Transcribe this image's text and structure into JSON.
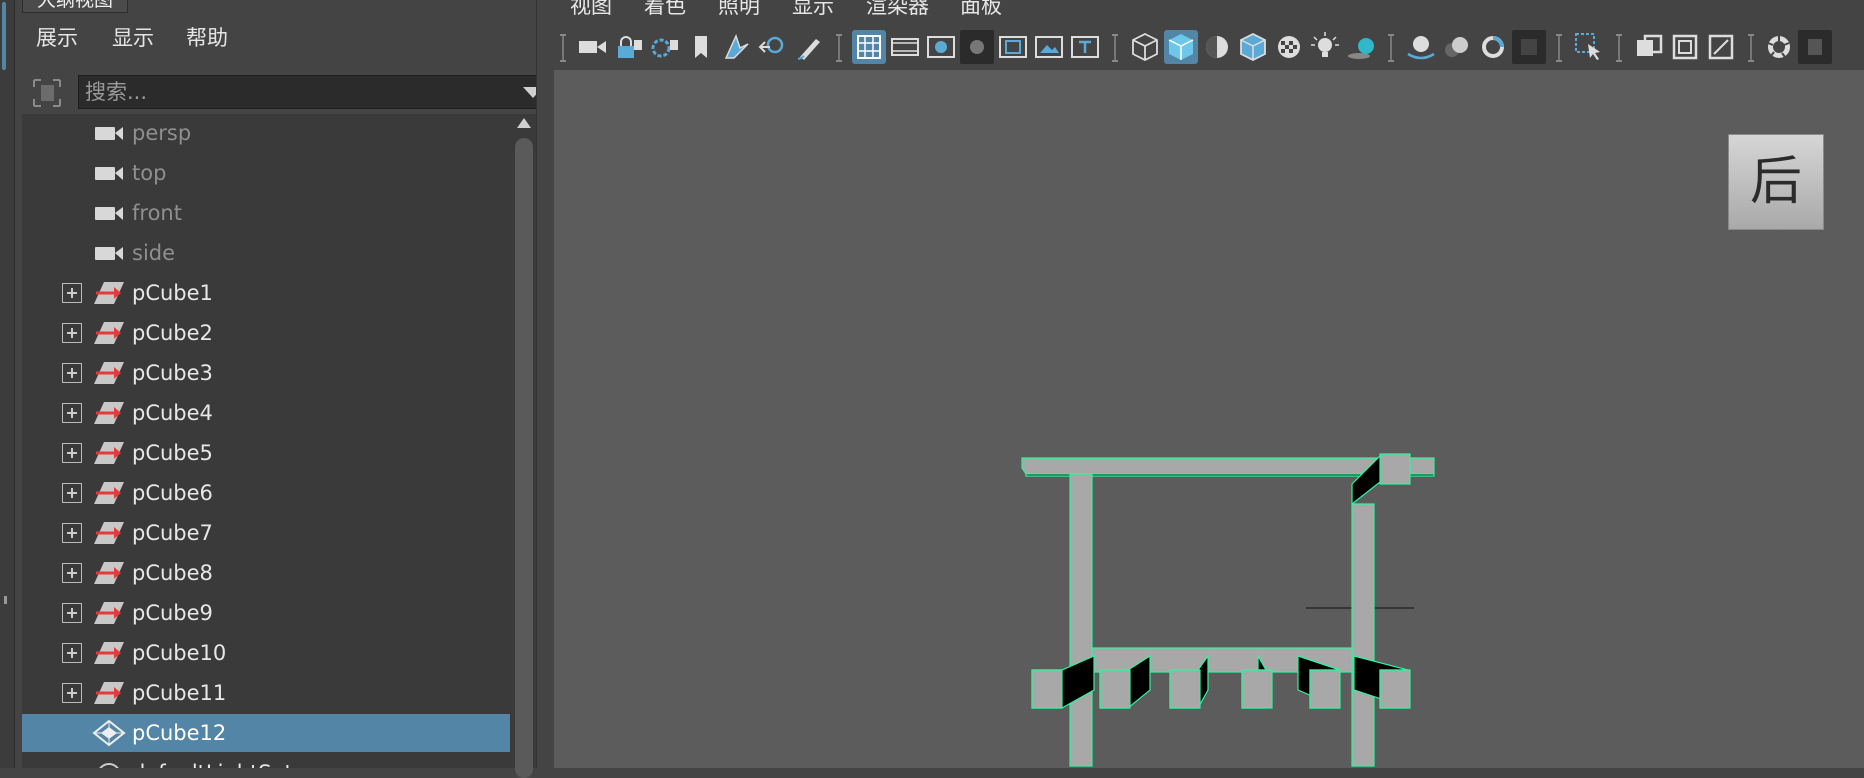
{
  "outliner": {
    "tab_title": "大纲视图",
    "menu": [
      "展示",
      "显示",
      "帮助"
    ],
    "search": {
      "placeholder": "搜索...",
      "value": ""
    },
    "items": [
      {
        "label": "persp",
        "type": "camera",
        "expandable": false,
        "dim": true
      },
      {
        "label": "top",
        "type": "camera",
        "expandable": false,
        "dim": true
      },
      {
        "label": "front",
        "type": "camera",
        "expandable": false,
        "dim": true
      },
      {
        "label": "side",
        "type": "camera",
        "expandable": false,
        "dim": true
      },
      {
        "label": "pCube1",
        "type": "mesh",
        "expandable": true
      },
      {
        "label": "pCube2",
        "type": "mesh",
        "expandable": true
      },
      {
        "label": "pCube3",
        "type": "mesh",
        "expandable": true
      },
      {
        "label": "pCube4",
        "type": "mesh",
        "expandable": true
      },
      {
        "label": "pCube5",
        "type": "mesh",
        "expandable": true
      },
      {
        "label": "pCube6",
        "type": "mesh",
        "expandable": true
      },
      {
        "label": "pCube7",
        "type": "mesh",
        "expandable": true
      },
      {
        "label": "pCube8",
        "type": "mesh",
        "expandable": true
      },
      {
        "label": "pCube9",
        "type": "mesh",
        "expandable": true
      },
      {
        "label": "pCube10",
        "type": "mesh",
        "expandable": true
      },
      {
        "label": "pCube11",
        "type": "mesh",
        "expandable": true
      },
      {
        "label": "pCube12",
        "type": "mesh-selected",
        "expandable": false,
        "selected": true
      },
      {
        "label": "defaultLightSet",
        "type": "set",
        "expandable": false
      }
    ]
  },
  "viewport": {
    "menu": [
      "视图",
      "着色",
      "照明",
      "显示",
      "渲染器",
      "面板"
    ],
    "view_cube_label": "后",
    "colors": {
      "accent": "#5285a6",
      "wireframe": "#2ef5a0",
      "mesh_face": "#a8a8a8",
      "mesh_dark": "#000000",
      "background": "#5c5c5c"
    }
  }
}
